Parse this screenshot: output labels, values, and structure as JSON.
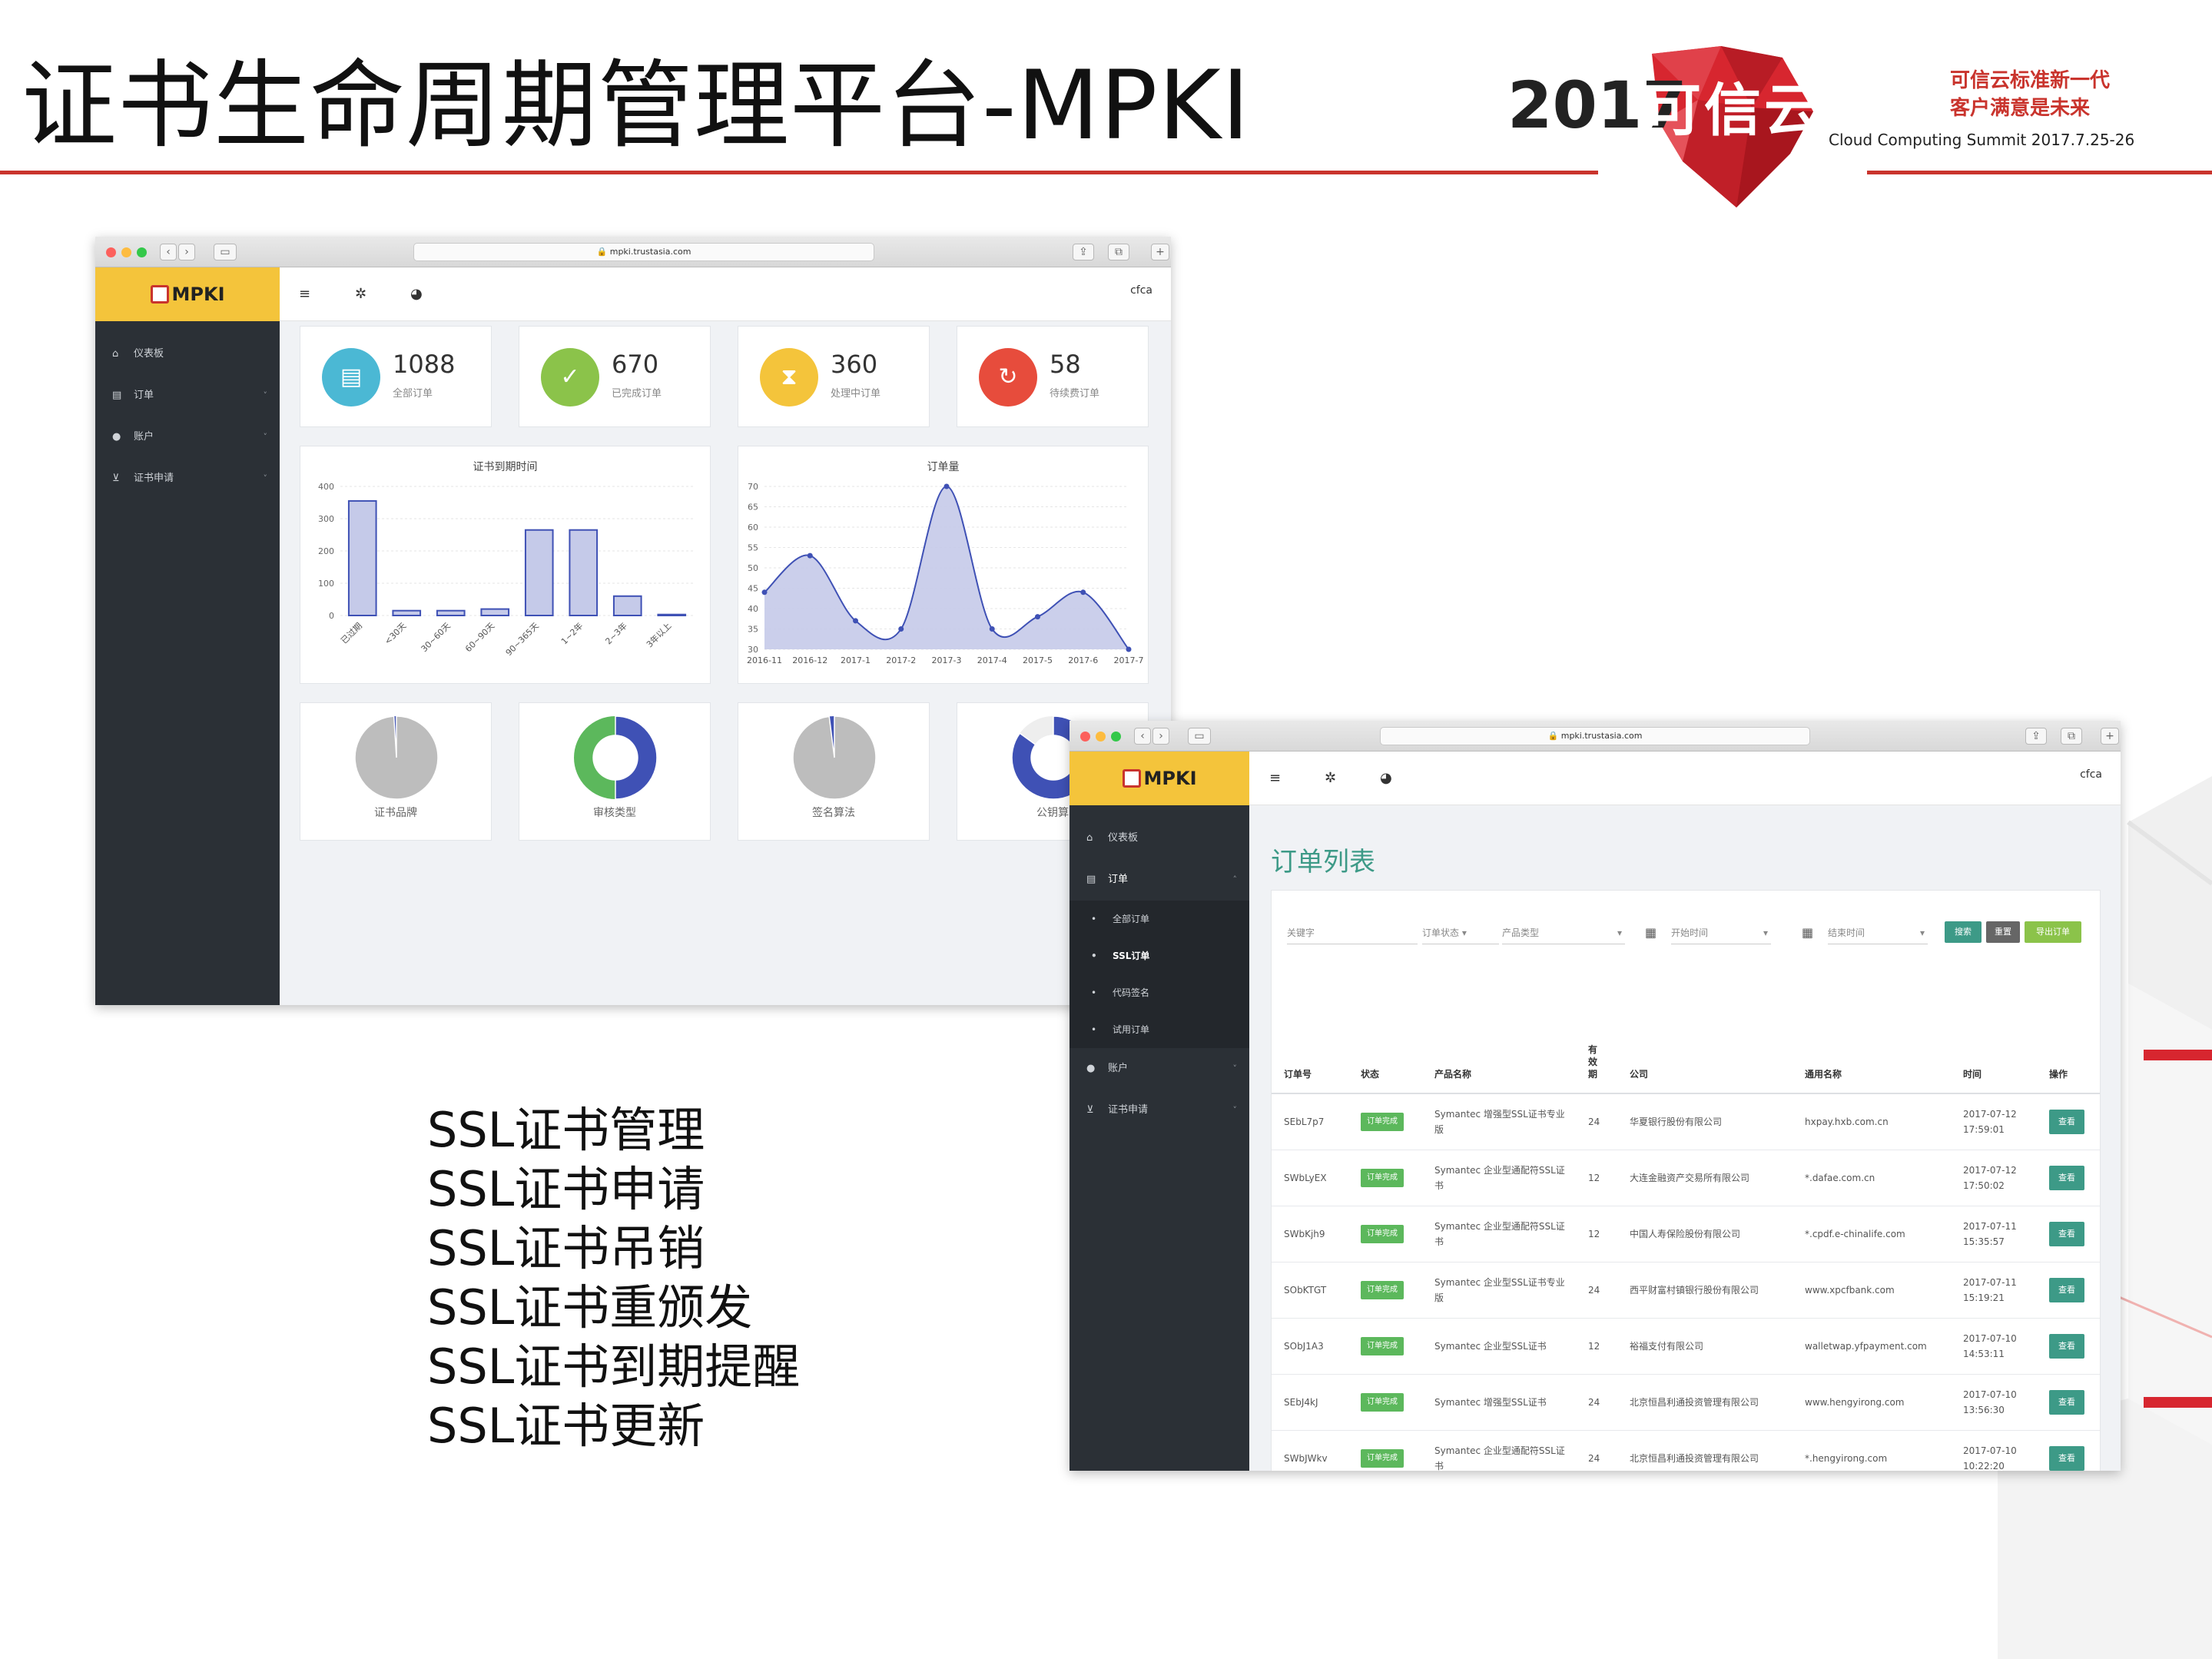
{
  "slide": {
    "title": "证书生命周期管理平台-MPKI",
    "summit_year": "2017",
    "summit_name": "可信云大会",
    "slogan_line1": "可信云标准新一代",
    "slogan_line2": "客户满意是未来",
    "summit_en": "Cloud Computing Summit 2017.7.25-26",
    "features": [
      "SSL证书管理",
      "SSL证书申请",
      "SSL证书吊销",
      "SSL证书重颁发",
      "SSL证书到期提醒",
      "SSL证书更新"
    ]
  },
  "colors": {
    "accent": "#c9342d",
    "brand": "#f4c43b",
    "sidebar": "#2b3036",
    "teal": "#3d9a87",
    "green": "#5cb85c"
  },
  "dashboard": {
    "url": "mpki.trustasia.com",
    "brand": "MPKI",
    "user": "cfca",
    "toolbar_icons": [
      "menu-icon",
      "gear-icon",
      "palette-icon"
    ],
    "sidebar": [
      {
        "icon": "home-icon",
        "label": "仪表板"
      },
      {
        "icon": "clipboard-icon",
        "label": "订单"
      },
      {
        "icon": "user-icon",
        "label": "账户"
      },
      {
        "icon": "cart-icon",
        "label": "证书申请"
      }
    ],
    "stats": [
      {
        "value": "1088",
        "label": "全部订单",
        "color": "#4bb8d4",
        "icon": "clipboard-icon",
        "glyph": "▤"
      },
      {
        "value": "670",
        "label": "已完成订单",
        "color": "#8bc34a",
        "icon": "check-icon",
        "glyph": "✓"
      },
      {
        "value": "360",
        "label": "处理中订单",
        "color": "#f4c43b",
        "icon": "hourglass-icon",
        "glyph": "⧗"
      },
      {
        "value": "58",
        "label": "待续费订单",
        "color": "#e74c3c",
        "icon": "refresh-icon",
        "glyph": "↻"
      }
    ],
    "pies": [
      {
        "label": "证书品牌",
        "share": 0.99,
        "color": "#bdbdbd",
        "minor_color": "#4a5bb5",
        "kind": "pie"
      },
      {
        "label": "审核类型",
        "share": 0.5,
        "color": "#3f51b5",
        "minor_color": "#5cb85c",
        "kind": "donut"
      },
      {
        "label": "签名算法",
        "share": 0.98,
        "color": "#bdbdbd",
        "minor_color": "#3f51b5",
        "kind": "pie"
      },
      {
        "label": "公钥算",
        "share": 0.85,
        "color": "#3f51b5",
        "minor_color": "#eeeeee",
        "kind": "donut"
      }
    ]
  },
  "chart_data": [
    {
      "type": "bar",
      "title": "证书到期时间",
      "categories": [
        "已过期",
        "<30天",
        "30~60天",
        "60~90天",
        "90~365天",
        "1~2年",
        "2~3年",
        "3年以上"
      ],
      "values": [
        355,
        15,
        15,
        20,
        265,
        265,
        60,
        3
      ],
      "ylim": [
        0,
        400
      ],
      "yticks": [
        0,
        100,
        200,
        300,
        400
      ],
      "color": "#c5cae9",
      "stroke": "#3f51b5",
      "grid": true
    },
    {
      "type": "area",
      "title": "订单量",
      "categories": [
        "2016-11",
        "2016-12",
        "2017-1",
        "2017-2",
        "2017-3",
        "2017-4",
        "2017-5",
        "2017-6",
        "2017-7"
      ],
      "values": [
        44,
        53,
        37,
        35,
        70,
        35,
        38,
        44,
        30
      ],
      "ylim": [
        30,
        70
      ],
      "yticks": [
        30,
        35,
        40,
        45,
        50,
        55,
        60,
        65,
        70
      ],
      "color": "#c5cae9",
      "stroke": "#3f51b5",
      "grid": true
    }
  ],
  "orders_window": {
    "url": "mpki.trustasia.com",
    "brand": "MPKI",
    "user": "cfca",
    "title": "订单列表",
    "sidebar": [
      {
        "icon": "home-icon",
        "label": "仪表板"
      },
      {
        "icon": "clipboard-icon",
        "label": "订单",
        "arrow": "˄"
      }
    ],
    "submenu": [
      "全部订单",
      "SSL订单",
      "代码签名",
      "试用订单"
    ],
    "sidebar_tail": [
      {
        "icon": "user-icon",
        "label": "账户"
      },
      {
        "icon": "cart-icon",
        "label": "证书申请"
      }
    ],
    "filters": {
      "keyword": "关键字",
      "status": "订单状态",
      "product": "产品类型",
      "start": "开始时间",
      "end": "结束时间",
      "search": "搜索",
      "reset": "重置",
      "export": "导出订单"
    },
    "columns": [
      "订单号",
      "状态",
      "产品名称",
      "有效期",
      "公司",
      "通用名称",
      "时间",
      "操作"
    ],
    "rows": [
      {
        "id": "SEbL7p7",
        "status": "订单完成",
        "product": "Symantec 增强型SSL证书专业版",
        "term": "24",
        "company": "华夏银行股份有限公司",
        "cn": "hxpay.hxb.com.cn",
        "date": "2017-07-12",
        "time": "17:59:01",
        "action": "查看"
      },
      {
        "id": "SWbLyEX",
        "status": "订单完成",
        "product": "Symantec 企业型通配符SSL证书",
        "term": "12",
        "company": "大连金融资产交易所有限公司",
        "cn": "*.dafae.com.cn",
        "date": "2017-07-12",
        "time": "17:50:02",
        "action": "查看"
      },
      {
        "id": "SWbKjh9",
        "status": "订单完成",
        "product": "Symantec 企业型通配符SSL证书",
        "term": "12",
        "company": "中国人寿保险股份有限公司",
        "cn": "*.cpdf.e-chinalife.com",
        "date": "2017-07-11",
        "time": "15:35:57",
        "action": "查看"
      },
      {
        "id": "SObKTGT",
        "status": "订单完成",
        "product": "Symantec 企业型SSL证书专业版",
        "term": "24",
        "company": "西平财富村镇银行股份有限公司",
        "cn": "www.xpcfbank.com",
        "date": "2017-07-11",
        "time": "15:19:21",
        "action": "查看"
      },
      {
        "id": "SObJ1A3",
        "status": "订单完成",
        "product": "Symantec 企业型SSL证书",
        "term": "12",
        "company": "裕福支付有限公司",
        "cn": "walletwap.yfpayment.com",
        "date": "2017-07-10",
        "time": "14:53:11",
        "action": "查看"
      },
      {
        "id": "SEbJ4kJ",
        "status": "订单完成",
        "product": "Symantec 增强型SSL证书",
        "term": "24",
        "company": "北京恒昌利通投资管理有限公司",
        "cn": "www.hengyirong.com",
        "date": "2017-07-10",
        "time": "13:56:30",
        "action": "查看"
      },
      {
        "id": "SWbJWkv",
        "status": "订单完成",
        "product": "Symantec 企业型通配符SSL证书",
        "term": "24",
        "company": "北京恒昌利通投资管理有限公司",
        "cn": "*.hengyirong.com",
        "date": "2017-07-10",
        "time": "10:22:20",
        "action": "查看"
      }
    ]
  }
}
